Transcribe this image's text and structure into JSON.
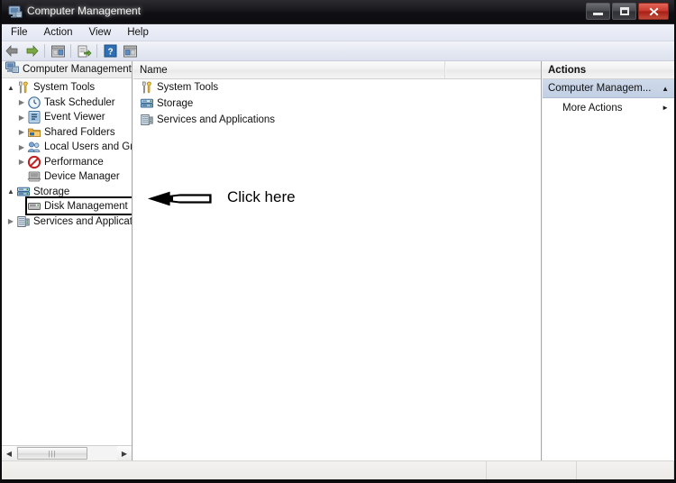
{
  "window": {
    "title": "Computer Management",
    "icon": "computer-management-icon",
    "controls": {
      "minimize": "Minimize",
      "maximize": "Maximize",
      "close": "Close"
    }
  },
  "menubar": {
    "items": [
      {
        "label": "File"
      },
      {
        "label": "Action"
      },
      {
        "label": "View"
      },
      {
        "label": "Help"
      }
    ]
  },
  "toolbar": {
    "buttons": [
      {
        "name": "back-icon",
        "title": "Back"
      },
      {
        "name": "forward-icon",
        "title": "Forward"
      },
      {
        "name": "show-hide-console-tree-icon",
        "title": "Show/Hide Console Tree"
      },
      {
        "name": "export-list-icon",
        "title": "Export List"
      },
      {
        "name": "help-icon",
        "title": "Help"
      },
      {
        "name": "show-hide-action-pane-icon",
        "title": "Show/Hide Action Pane"
      }
    ]
  },
  "tree": {
    "root": {
      "label": "Computer Management",
      "icon": "computer-icon"
    },
    "items": [
      {
        "label": "System Tools",
        "icon": "system-tools-icon",
        "indent": 0,
        "twisty": "open",
        "selected": false
      },
      {
        "label": "Task Scheduler",
        "icon": "task-scheduler-icon",
        "indent": 1,
        "twisty": "closed",
        "selected": false
      },
      {
        "label": "Event Viewer",
        "icon": "event-viewer-icon",
        "indent": 1,
        "twisty": "closed",
        "selected": false
      },
      {
        "label": "Shared Folders",
        "icon": "shared-folders-icon",
        "indent": 1,
        "twisty": "closed",
        "selected": false
      },
      {
        "label": "Local Users and Gro",
        "icon": "local-users-icon",
        "indent": 1,
        "twisty": "closed",
        "selected": false
      },
      {
        "label": "Performance",
        "icon": "performance-icon",
        "indent": 1,
        "twisty": "closed",
        "selected": false
      },
      {
        "label": "Device Manager",
        "icon": "device-manager-icon",
        "indent": 1,
        "twisty": "none",
        "selected": false
      },
      {
        "label": "Storage",
        "icon": "storage-icon",
        "indent": 0,
        "twisty": "open",
        "selected": false
      },
      {
        "label": "Disk Management",
        "icon": "disk-management-icon",
        "indent": 1,
        "twisty": "none",
        "selected": true
      },
      {
        "label": "Services and Applicat",
        "icon": "services-icon",
        "indent": 0,
        "twisty": "closed",
        "selected": false
      }
    ],
    "scrollbar": {
      "left_arrow": "◄",
      "right_arrow": "►",
      "grip": "|||"
    }
  },
  "list": {
    "columns": [
      "Name"
    ],
    "rows": [
      {
        "name": "System Tools",
        "icon": "system-tools-icon"
      },
      {
        "name": "Storage",
        "icon": "storage-icon"
      },
      {
        "name": "Services and Applications",
        "icon": "services-icon"
      }
    ]
  },
  "annotation": {
    "text": "Click here",
    "arrow": "left-arrow-annotation",
    "color": "#000000"
  },
  "actions": {
    "header": "Actions",
    "group": {
      "label": "Computer Managem...",
      "collapse_icon": "▲"
    },
    "items": [
      {
        "label": "More Actions",
        "submenu_icon": "►"
      }
    ]
  },
  "statusbar": {
    "segments": [
      "",
      "",
      ""
    ]
  },
  "colors": {
    "titlebar": "#18181c",
    "close_button": "#c7392c",
    "actions_group_bg": "#c8d5e7",
    "highlight_box": "#000000"
  }
}
